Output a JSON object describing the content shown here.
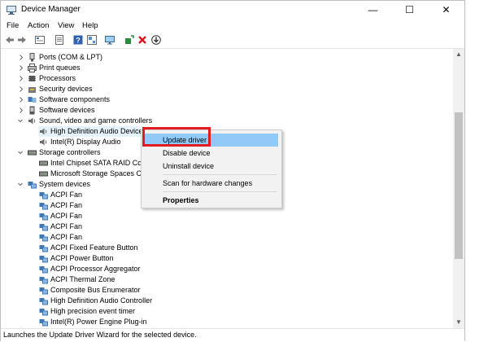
{
  "window": {
    "title": "Device Manager",
    "controls": {
      "minimize": "—",
      "maximize": "☐",
      "close": "✕"
    }
  },
  "menu": [
    "File",
    "Action",
    "View",
    "Help"
  ],
  "toolbar": {
    "icons": [
      "back-arrow-icon",
      "forward-arrow-icon",
      "device-tree-icon",
      "properties-icon",
      "help-icon",
      "device-view-icon",
      "monitor-icon",
      "add-driver-icon",
      "uninstall-red-x-icon",
      "download-driver-icon"
    ]
  },
  "tree": {
    "categories": [
      {
        "label": "Ports (COM & LPT)",
        "expanded": false,
        "icon": "port-icon"
      },
      {
        "label": "Print queues",
        "expanded": false,
        "icon": "printer-icon"
      },
      {
        "label": "Processors",
        "expanded": false,
        "icon": "processor-icon"
      },
      {
        "label": "Security devices",
        "expanded": false,
        "icon": "security-icon"
      },
      {
        "label": "Software components",
        "expanded": false,
        "icon": "component-icon"
      },
      {
        "label": "Software devices",
        "expanded": false,
        "icon": "software-device-icon"
      },
      {
        "label": "Sound, video and game controllers",
        "expanded": true,
        "icon": "speaker-icon",
        "children": [
          "High Definition Audio Device",
          "Intel(R) Display Audio"
        ]
      },
      {
        "label": "Storage controllers",
        "expanded": true,
        "icon": "storage-icon",
        "children": [
          "Intel Chipset SATA RAID Cont",
          "Microsoft Storage Spaces Co"
        ]
      },
      {
        "label": "System devices",
        "expanded": true,
        "icon": "system-icon",
        "children": [
          "ACPI Fan",
          "ACPI Fan",
          "ACPI Fan",
          "ACPI Fan",
          "ACPI Fan",
          "ACPI Fixed Feature Button",
          "ACPI Power Button",
          "ACPI Processor Aggregator",
          "ACPI Thermal Zone",
          "Composite Bus Enumerator",
          "High Definition Audio Controller",
          "High precision event timer",
          "Intel(R) Power Engine Plug-in"
        ]
      }
    ]
  },
  "context_menu": {
    "items": [
      "Update driver",
      "Disable device",
      "Uninstall device",
      "Scan for hardware changes",
      "Properties"
    ],
    "highlighted": "Update driver"
  },
  "status": "Launches the Update Driver Wizard for the selected device.",
  "colors": {
    "highlight": "#91c9f7",
    "red_frame": "#e11b22",
    "selection": "#e5f1fb"
  }
}
